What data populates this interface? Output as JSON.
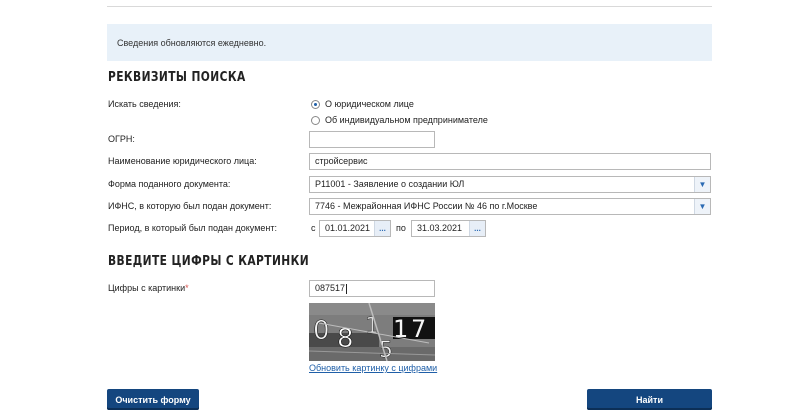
{
  "notice": "Сведения обновляются ежедневно.",
  "search_section": {
    "title": "РЕКВИЗИТЫ ПОИСКА",
    "search_for_label": "Искать сведения:",
    "radio_options": [
      {
        "label": "О юридическом лице",
        "selected": true
      },
      {
        "label": "Об индивидуальном предпринимателе",
        "selected": false
      }
    ],
    "ogrn_label": "ОГРН:",
    "ogrn_value": "",
    "name_label": "Наименование юридического лица:",
    "name_value": "стройсервис",
    "doc_form_label": "Форма поданного документа:",
    "doc_form_value": "Р11001 - Заявление о создании ЮЛ",
    "ifns_label": "ИФНС, в которую был подан документ:",
    "ifns_value": "7746 - Межрайонная ИФНС России № 46 по г.Москве",
    "period_label": "Период, в который был подан документ:",
    "period_from_prefix": "с",
    "period_from": "01.01.2021",
    "period_to_prefix": "по",
    "period_to": "31.03.2021",
    "date_button": "..."
  },
  "captcha_section": {
    "title": "ВВЕДИТЕ ЦИФРЫ С КАРТИНКИ",
    "digits_label": "Цифры с картинки",
    "required_mark": "*",
    "digits_value": "087517",
    "refresh_link": "Обновить картинку с цифрами"
  },
  "buttons": {
    "clear": "Очистить форму",
    "find": "Найти"
  },
  "colors": {
    "accent": "#14467f",
    "link": "#1f5fa8",
    "notice_bg": "#e8f1f9"
  }
}
